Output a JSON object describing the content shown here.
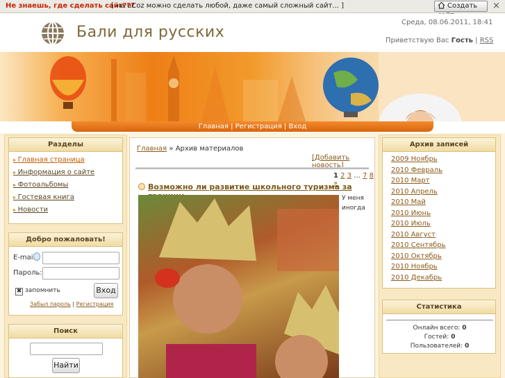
{
  "topbar": {
    "question": "Не знаешь, где сделать сайт???",
    "text": "[ на uCoz можно сделать любой, даже самый сложный сайт... ]",
    "create_button": "Создать сайт",
    "close": "×"
  },
  "header": {
    "title": "Бали для русских",
    "date": "Среда, 08.06.2011, 18:41",
    "greet_prefix": "Приветствую Вас",
    "guest": "Гость",
    "sep": "|",
    "rss": "RSS"
  },
  "nav": {
    "home": "Главная",
    "sep": "|",
    "register": "Регистрация",
    "login": "Вход"
  },
  "sections": {
    "title": "Разделы",
    "items": [
      "Главная страница",
      "Информация о сайте",
      "Фотоальбомы",
      "Гостевая книга",
      "Новости"
    ]
  },
  "welcome": {
    "title": "Добро пожаловать!",
    "email_label": "E-mail:",
    "password_label": "Пароль:",
    "remember": "запомнить",
    "login_button": "Вход",
    "forgot": "Забыл пароль",
    "sep": "|",
    "register": "Регистрация"
  },
  "search": {
    "title": "Поиск",
    "button": "Найти"
  },
  "main": {
    "breadcrumb_home": "Главная",
    "breadcrumb_sep": "»",
    "breadcrumb_current": "Архив материалов",
    "add_news": "[Добавить новость]",
    "pages": {
      "current": "1",
      "p2": "2",
      "p3": "3",
      "dots": "...",
      "p7": "7",
      "p8": "8",
      "next": "»"
    },
    "article_title": "Возможно ли развитие школьного туризма за границу",
    "article_text1": "У меня",
    "article_text2": "иногда"
  },
  "archive": {
    "title": "Архив записей",
    "items": [
      "2009 Ноябрь",
      "2010 Февраль",
      "2010 Март",
      "2010 Апрель",
      "2010 Май",
      "2010 Июнь",
      "2010 Июль",
      "2010 Август",
      "2010 Сентябрь",
      "2010 Октябрь",
      "2010 Ноябрь",
      "2010 Декабрь"
    ]
  },
  "stats": {
    "title": "Статистика",
    "online_label": "Онлайн всего:",
    "online": "0",
    "guests_label": "Гостей:",
    "guests": "0",
    "users_label": "Пользователей:",
    "users": "0"
  },
  "colors": {
    "accent": "#ee7f16",
    "link": "#8a5a1a",
    "panel": "#f8e9c4"
  }
}
